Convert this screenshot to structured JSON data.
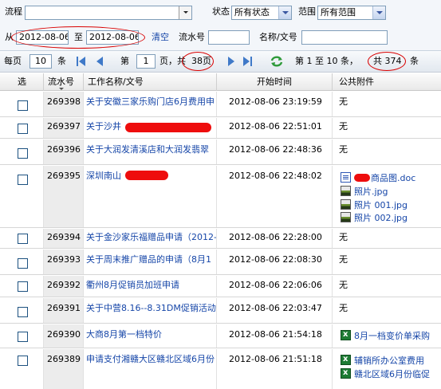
{
  "filter": {
    "process_label": "流程",
    "process_value": "",
    "status_label": "状态",
    "status_value": "所有状态",
    "scope_label": "范围",
    "scope_value": "所有范围",
    "from_label": "从",
    "date_from": "2012-08-06",
    "to_label": "至",
    "date_to": "2012-08-06",
    "clear_label": "清空",
    "serial_label": "流水号",
    "serial_value": "",
    "name_label": "名称/文号",
    "name_value": ""
  },
  "pager": {
    "per_page_label": "每页",
    "per_page_value": "10",
    "per_page_unit": "条",
    "page_label": "第",
    "page_value": "1",
    "page_total_text": "页，共",
    "page_total": "38页",
    "range_text": "第 1 至 10 条，",
    "total_text": "共 374",
    "total_unit": "条"
  },
  "table": {
    "headers": [
      "选",
      "流水号",
      "工作名称/文号",
      "开始时间",
      "公共附件"
    ],
    "rows": [
      {
        "id": "269398",
        "name": "关于安徽三家乐购门店6月费用申",
        "time": "2012-08-06 23:19:59",
        "att": [
          "无"
        ]
      },
      {
        "id": "269397",
        "name": "关于沙井",
        "time": "2012-08-06 22:51:01",
        "att": [
          "无"
        ]
      },
      {
        "id": "269396",
        "name": "关于大润发清溪店和大润发翡翠",
        "time": "2012-08-06 22:48:36",
        "att": [
          "无"
        ]
      },
      {
        "id": "269395",
        "name": "深圳南山",
        "time": "2012-08-06 22:48:02",
        "att": [
          "商品图.doc",
          "照片.jpg",
          "照片 001.jpg",
          "照片 002.jpg"
        ]
      },
      {
        "id": "269394",
        "name": "关于金沙家乐福赠品申请（2012-",
        "time": "2012-08-06 22:28:00",
        "att": [
          "无"
        ]
      },
      {
        "id": "269393",
        "name": "关于周末推广赠品的申请（8月1",
        "time": "2012-08-06 22:08:30",
        "att": [
          "无"
        ]
      },
      {
        "id": "269392",
        "name": "衢州8月促销员加班申请",
        "time": "2012-08-06 22:06:06",
        "att": [
          "无"
        ]
      },
      {
        "id": "269391",
        "name": "关于中营8.16--8.31DM促销活动",
        "time": "2012-08-06 22:03:47",
        "att": [
          "无"
        ]
      },
      {
        "id": "269390",
        "name": "大商8月第一档特价",
        "time": "2012-08-06 21:54:18",
        "att": [
          "8月一档变价单采购"
        ]
      },
      {
        "id": "269389",
        "name": "申请支付湘赣大区赣北区域6月份",
        "time": "2012-08-06 21:51:18",
        "att": [
          "辅销所办公室费用",
          "赣北区域6月份临促"
        ]
      }
    ]
  }
}
